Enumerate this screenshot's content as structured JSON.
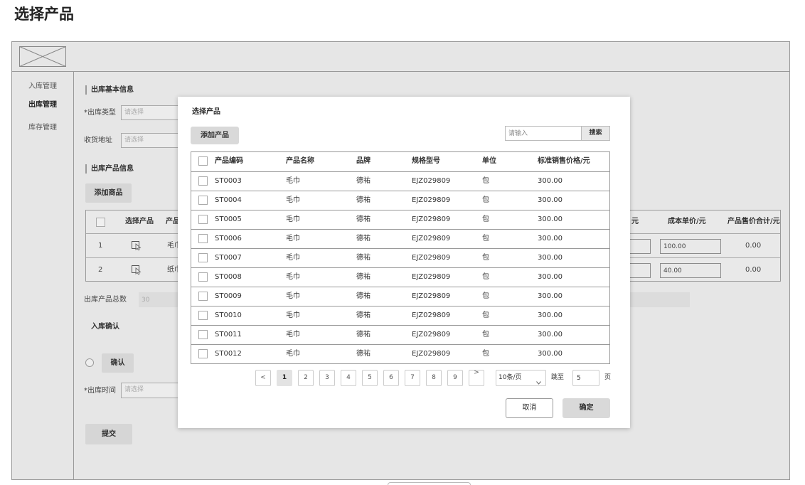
{
  "page_title": "选择产品",
  "colors": {
    "frame_bg": "#e6e6e6",
    "modal_bg": "#ffffff",
    "button_bg": "#d6d6d6",
    "border": "#999999",
    "text": "#333333"
  },
  "icons": {
    "logo": "image-placeholder-icon",
    "select_product": "cursor-select-icon",
    "page_size": "chevron-down-icon"
  },
  "sidebar": {
    "items": [
      {
        "label": "入库管理",
        "active": false
      },
      {
        "label": "出库管理",
        "active": true
      },
      {
        "label": "库存管理",
        "active": false
      }
    ]
  },
  "form": {
    "basic_section_title": "出库基本信息",
    "out_type": {
      "label": "*出库类型",
      "placeholder": "请选择"
    },
    "address": {
      "label": "收货地址",
      "placeholder": "请选择"
    },
    "product_section_title": "出库产品信息",
    "add_goods_button": "添加商品",
    "product_table": {
      "headers": {
        "select_product": "选择产品",
        "product": "产品",
        "partial_header": "元",
        "cost_price": "成本单价/元",
        "sale_total": "产品售价合计/元"
      },
      "rows": [
        {
          "index": "1",
          "product": "毛巾",
          "cost_price": "100.00",
          "sale_total": "0.00"
        },
        {
          "index": "2",
          "product": "纸巾",
          "cost_price": "40.00",
          "sale_total": "0.00"
        }
      ]
    },
    "total_count": {
      "label": "出库产品总数",
      "value": "30"
    },
    "confirm_section_title": "入库确认",
    "confirm_button": "确认",
    "out_time": {
      "label": "*出库时间",
      "placeholder": "请选择"
    },
    "submit_button": "提交"
  },
  "modal": {
    "title": "选择产品",
    "add_product_button": "添加产品",
    "search": {
      "placeholder": "请输入",
      "button": "搜索"
    },
    "table": {
      "headers": {
        "code": "产品编码",
        "name": "产品名称",
        "brand": "品牌",
        "model": "规格型号",
        "unit": "单位",
        "price": "标准销售价格/元"
      },
      "rows": [
        {
          "code": "ST0003",
          "name": "毛巾",
          "brand": "德祐",
          "model": "EJZ029809",
          "unit": "包",
          "price": "300.00"
        },
        {
          "code": "ST0004",
          "name": "毛巾",
          "brand": "德祐",
          "model": "EJZ029809",
          "unit": "包",
          "price": "300.00"
        },
        {
          "code": "ST0005",
          "name": "毛巾",
          "brand": "德祐",
          "model": "EJZ029809",
          "unit": "包",
          "price": "300.00"
        },
        {
          "code": "ST0006",
          "name": "毛巾",
          "brand": "德祐",
          "model": "EJZ029809",
          "unit": "包",
          "price": "300.00"
        },
        {
          "code": "ST0007",
          "name": "毛巾",
          "brand": "德祐",
          "model": "EJZ029809",
          "unit": "包",
          "price": "300.00"
        },
        {
          "code": "ST0008",
          "name": "毛巾",
          "brand": "德祐",
          "model": "EJZ029809",
          "unit": "包",
          "price": "300.00"
        },
        {
          "code": "ST0009",
          "name": "毛巾",
          "brand": "德祐",
          "model": "EJZ029809",
          "unit": "包",
          "price": "300.00"
        },
        {
          "code": "ST0010",
          "name": "毛巾",
          "brand": "德祐",
          "model": "EJZ029809",
          "unit": "包",
          "price": "300.00"
        },
        {
          "code": "ST0011",
          "name": "毛巾",
          "brand": "德祐",
          "model": "EJZ029809",
          "unit": "包",
          "price": "300.00"
        },
        {
          "code": "ST0012",
          "name": "毛巾",
          "brand": "德祐",
          "model": "EJZ029809",
          "unit": "包",
          "price": "300.00"
        }
      ]
    },
    "pagination": {
      "prev": "<",
      "pages": [
        "1",
        "2",
        "3",
        "4",
        "5",
        "6",
        "7",
        "8",
        "9"
      ],
      "current_index": 0,
      "next": ">",
      "page_size": "10条/页",
      "jump_label": "跳至",
      "jump_value": "5",
      "page_suffix": "页"
    },
    "cancel_button": "取消",
    "confirm_button": "确定"
  }
}
